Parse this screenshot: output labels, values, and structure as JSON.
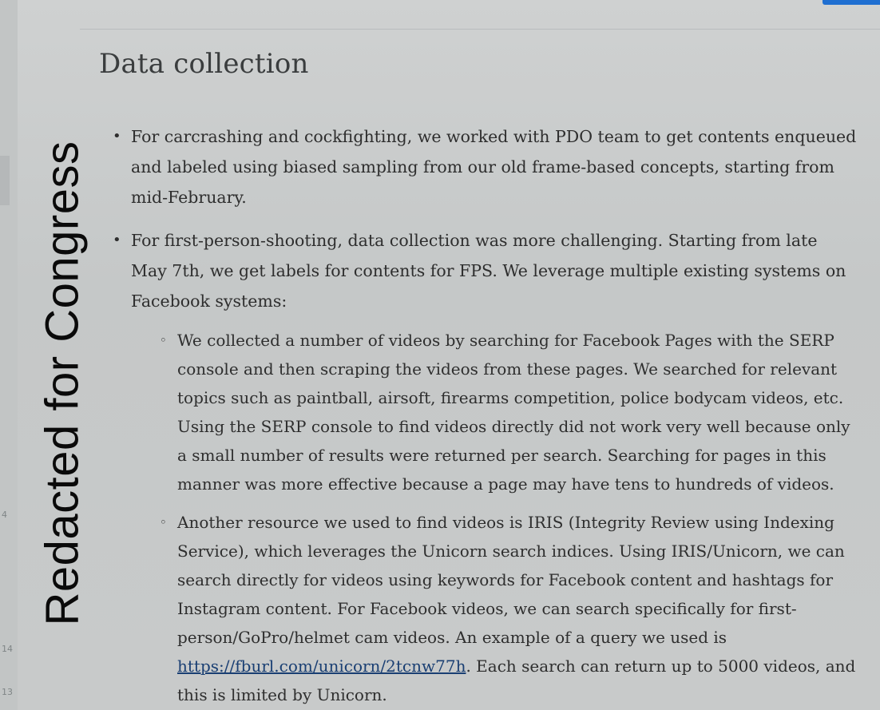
{
  "gutter": {
    "line_numbers": [
      "4",
      "14",
      "13"
    ]
  },
  "watermark": "Redacted for Congress",
  "heading": "Data collection",
  "bullets": [
    {
      "text": "For carcrashing and cockfighting, we worked with PDO team to get contents enqueued and labeled using biased sampling from our old frame-based concepts, starting from mid-February."
    },
    {
      "text": "For first-person-shooting, data collection was more challenging. Starting from late May 7th, we get labels for contents for FPS. We leverage multiple existing systems on Facebook systems:"
    }
  ],
  "sub_bullets": [
    {
      "text": "We collected a number of videos by searching for Facebook Pages with the SERP console and then scraping the videos from these pages. We searched for relevant topics such as paintball, airsoft, firearms competition, police bodycam videos, etc. Using the SERP console to find videos directly did not work very well because only a small number of results were returned per search. Searching for pages in this manner was more effective because a page may have tens to hundreds of videos."
    },
    {
      "text_before": "Another resource we used to find videos is IRIS (Integrity Review using Indexing Service), which leverages the Unicorn search indices. Using IRIS/Unicorn, we can search directly for videos using keywords for Facebook content and hashtags for Instagram content. For Facebook videos, we can search specifically for first-person/GoPro/helmet cam videos. An example of a query we used is ",
      "link": "https://fburl.com/unicorn/2tcnw77h",
      "text_after": ". Each search can return up to 5000 videos, and this is limited by Unicorn."
    }
  ],
  "bullet_symbols": {
    "main": "•",
    "sub": "◦"
  },
  "colors": {
    "accent_button": "#1f6fd1",
    "link": "#1a3f73"
  }
}
